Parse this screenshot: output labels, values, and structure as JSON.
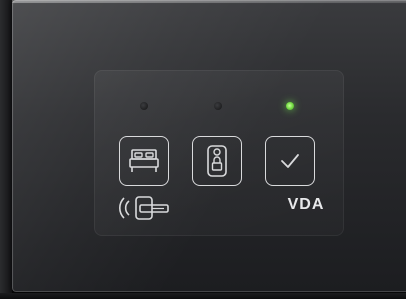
{
  "brand": {
    "logo_text": "VDA"
  },
  "indicators": [
    {
      "name": "do-not-disturb-indicator",
      "state": "off"
    },
    {
      "name": "make-up-room-indicator",
      "state": "off"
    },
    {
      "name": "ready-indicator",
      "state": "on",
      "color": "#7be04a"
    }
  ],
  "buttons": [
    {
      "name": "bed-button",
      "icon": "bed-icon"
    },
    {
      "name": "door-hanger-button",
      "icon": "door-hanger-lock-icon"
    },
    {
      "name": "confirm-button",
      "icon": "checkmark-icon"
    }
  ],
  "card_reader": {
    "icon": "card-reader-icon"
  },
  "colors": {
    "panel": "#2a2b2e",
    "icon_stroke": "#d9dadc",
    "led_on": "#7be04a"
  }
}
